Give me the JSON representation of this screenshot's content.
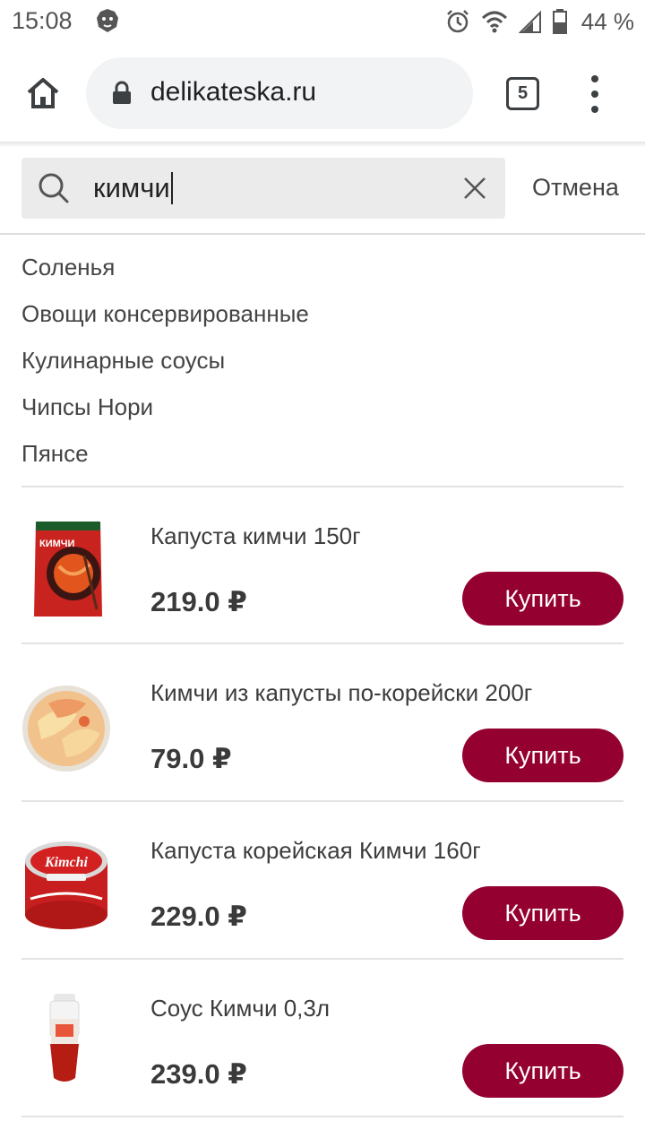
{
  "status_bar": {
    "time": "15:08",
    "battery_percent": "44 %",
    "icons": [
      "lion-app-icon",
      "alarm-icon",
      "wifi-icon",
      "signal-icon",
      "battery-icon"
    ]
  },
  "browser": {
    "url": "delikateska.ru",
    "tab_count": "5",
    "icons": [
      "home-icon",
      "lock-icon",
      "menu-dots-icon"
    ]
  },
  "search": {
    "value": "кимчи",
    "cancel_label": "Отмена"
  },
  "suggestions": [
    {
      "label": "Соленья"
    },
    {
      "label": "Овощи консервированные"
    },
    {
      "label": "Кулинарные соусы"
    },
    {
      "label": "Чипсы Нори"
    },
    {
      "label": "Пянсе"
    }
  ],
  "products": [
    {
      "name": "Капуста кимчи 150г",
      "price": "219.0 ₽",
      "buy_label": "Купить"
    },
    {
      "name": "Кимчи из капусты по-корейски 200г",
      "price": "79.0 ₽",
      "buy_label": "Купить"
    },
    {
      "name": "Капуста корейская Кимчи 160г",
      "price": "229.0 ₽",
      "buy_label": "Купить"
    },
    {
      "name": "Соус Кимчи 0,3л",
      "price": "239.0 ₽",
      "buy_label": "Купить"
    }
  ],
  "package_text": {
    "kimchi_pouch": "КИМЧИ",
    "kimchi_can": "Kimchi"
  },
  "colors": {
    "buy_button": "#94002f",
    "search_field": "#ebebeb",
    "url_box": "#f1f3f4"
  }
}
